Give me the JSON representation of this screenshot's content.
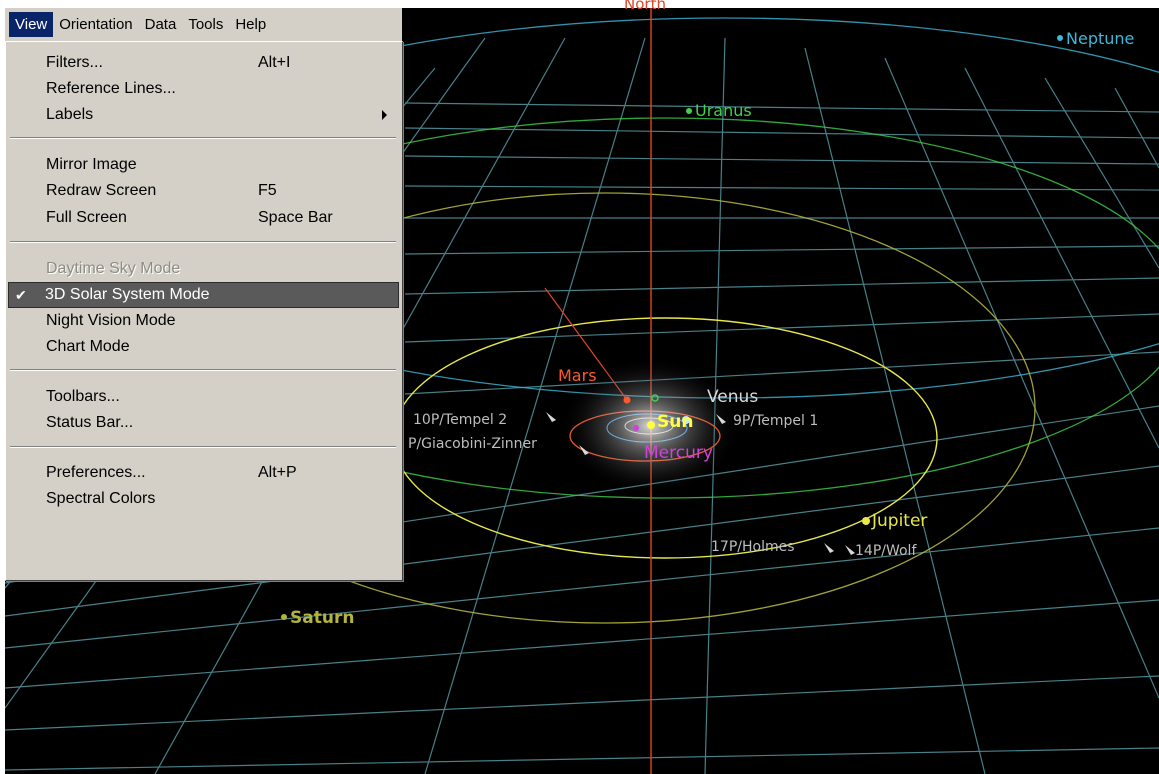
{
  "menubar": {
    "items": [
      "View",
      "Orientation",
      "Data",
      "Tools",
      "Help"
    ]
  },
  "view_menu": {
    "filters": {
      "label": "Filters...",
      "shortcut": "Alt+I"
    },
    "reference_lines": {
      "label": "Reference Lines..."
    },
    "labels": {
      "label": "Labels"
    },
    "mirror_image": {
      "label": "Mirror Image"
    },
    "redraw_screen": {
      "label": "Redraw Screen",
      "shortcut": "F5"
    },
    "full_screen": {
      "label": "Full Screen",
      "shortcut": "Space Bar"
    },
    "daytime_sky": {
      "label": "Daytime Sky Mode"
    },
    "solar_system": {
      "label": "3D Solar System Mode",
      "check": "✔"
    },
    "night_vision": {
      "label": "Night Vision Mode"
    },
    "chart_mode": {
      "label": "Chart Mode"
    },
    "toolbars": {
      "label": "Toolbars..."
    },
    "status_bar": {
      "label": "Status Bar..."
    },
    "preferences": {
      "label": "Preferences...",
      "shortcut": "Alt+P"
    },
    "spectral_colors": {
      "label": "Spectral Colors"
    }
  },
  "scene": {
    "north": "North",
    "planets": {
      "neptune": "Neptune",
      "uranus": "Uranus",
      "mars": "Mars",
      "venus": "Venus",
      "sun": "Sun",
      "mercury": "Mercury",
      "jupiter": "Jupiter",
      "saturn": "Saturn"
    },
    "comets": {
      "tempel2": "10P/Tempel 2",
      "giacobini": "P/Giacobini-Zinner",
      "tempel1": "9P/Tempel 1",
      "holmes": "17P/Holmes",
      "wolf": "14P/Wolf"
    },
    "colors": {
      "background": "#000000",
      "grid": "#4f8f98",
      "north_line": "#e0452a",
      "neptune": "#3fb7d8",
      "uranus": "#3fd24a",
      "mars": "#ff5a2c",
      "sun": "#ffff40",
      "mercury": "#cf43d9",
      "jupiter": "#e8e84a",
      "saturn": "#b3b33e",
      "menu_bg": "#d4d0c8",
      "menu_highlight": "#0a246a"
    }
  }
}
